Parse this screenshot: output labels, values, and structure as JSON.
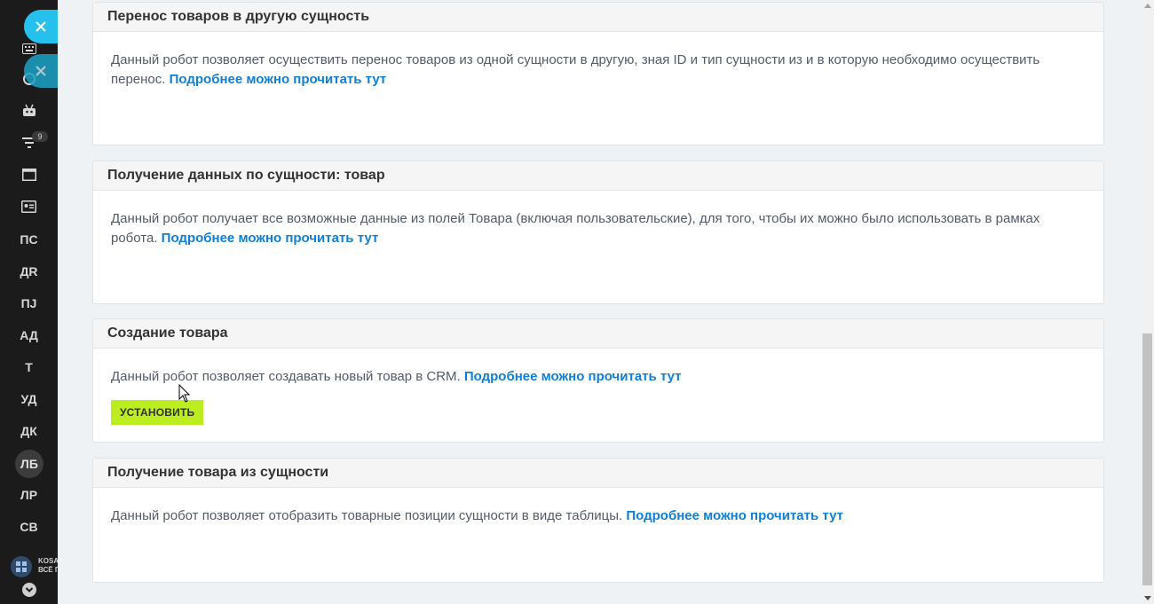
{
  "sidebar": {
    "items": [
      {
        "icon": "keyboard-icon"
      },
      {
        "icon": "circle-icon"
      },
      {
        "icon": "robot-icon"
      },
      {
        "icon": "filter-icon",
        "badge": "9"
      },
      {
        "icon": "window-icon"
      },
      {
        "icon": "contact-card-icon"
      },
      {
        "label": "ПС"
      },
      {
        "label": "ДR"
      },
      {
        "label": "ПJ"
      },
      {
        "label": "АД"
      },
      {
        "label": "Т"
      },
      {
        "label": "УД"
      },
      {
        "label": "ДК"
      },
      {
        "label": "ЛБ"
      },
      {
        "label": "ЛР"
      },
      {
        "label": "СВ"
      }
    ],
    "bottom_text_line1": "KOSA",
    "bottom_text_line2": "ВСЁ Г"
  },
  "cards": [
    {
      "title": "Перенос товаров в другую сущность",
      "description": "Данный робот позволяет осуществить перенос товаров из одной сущности в другую, зная ID и тип сущности из и в которую необходимо осуществить перенос.",
      "link": "Подробнее можно прочитать тут"
    },
    {
      "title": "Получение данных по сущности: товар",
      "description": "Данный робот получает все возможные данные из полей Товара (включая пользовательские), для того, чтобы их можно было использовать в рамках робота.",
      "link": "Подробнее можно прочитать тут"
    },
    {
      "title": "Создание товара",
      "description": "Данный робот позволяет создавать новый товар в CRM.",
      "link": "Подробнее можно прочитать тут",
      "button": "УСТАНОВИТЬ"
    },
    {
      "title": "Получение товара из сущности",
      "description": "Данный робот позволяет отобразить товарные позиции сущности в виде таблицы.",
      "link": "Подробнее можно прочитать тут"
    }
  ],
  "colors": {
    "link": "#0f7fd8",
    "install_button": "#bbed21",
    "close_button": "#25c1ec",
    "sidebar": "#1b1b1b"
  }
}
